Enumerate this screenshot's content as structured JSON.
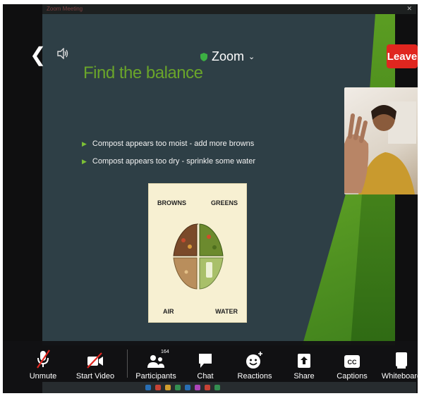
{
  "host_window": {
    "title": "Zoom Meeting",
    "close_glyph": "✕"
  },
  "topbar": {
    "back_icon": "chevron-left-icon",
    "speaker_icon": "speaker-icon",
    "meeting_title": "Zoom",
    "shield_color": "#3cb043",
    "leave_label": "Leave",
    "leave_color": "#e0261f"
  },
  "slide": {
    "title": "Find the balance",
    "title_color": "#6aa52a",
    "bullets": [
      "Compost appears too moist - add more browns",
      "Compost appears too dry - sprinkle some water"
    ],
    "diagram": {
      "labels": {
        "browns": "BROWNS",
        "greens": "GREENS",
        "air": "AIR",
        "water": "WATER"
      }
    }
  },
  "toolbar": {
    "unmute": "Unmute",
    "start_video": "Start Video",
    "participants": "Participants",
    "participants_count": "164",
    "chat": "Chat",
    "reactions": "Reactions",
    "share": "Share",
    "captions": "Captions",
    "captions_icon_text": "CC",
    "whiteboard": "Whiteboard"
  }
}
